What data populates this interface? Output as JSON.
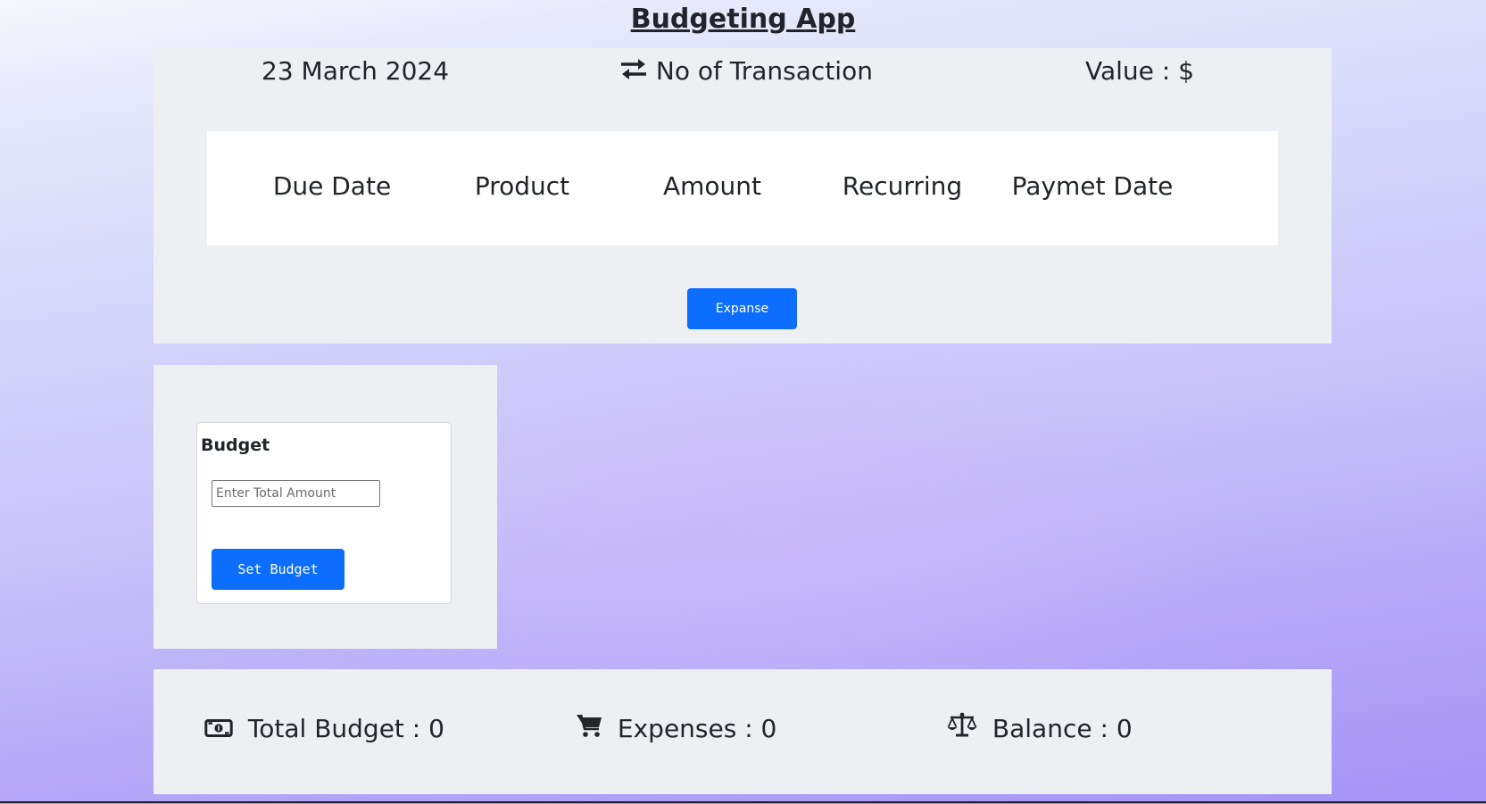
{
  "app": {
    "title": "Budgeting App"
  },
  "stats": {
    "date": "23 March 2024",
    "transactions_label": "No of Transaction",
    "transactions_icon": "exchange-arrows-icon",
    "value_label": "Value : $"
  },
  "table": {
    "columns": [
      "Due Date",
      "Product",
      "Amount",
      "Recurring",
      "Paymet Date"
    ]
  },
  "expanse_button": {
    "label": "Expanse"
  },
  "budget_form": {
    "label": "Budget",
    "input_placeholder": "Enter Total Amount",
    "input_value": "",
    "submit_label": "Set Budget"
  },
  "summary": {
    "total_budget": {
      "label": "Total Budget : 0",
      "icon": "money-bill-icon"
    },
    "expenses": {
      "label": "Expenses : 0",
      "icon": "shopping-cart-icon"
    },
    "balance": {
      "label": "Balance : 0",
      "icon": "balance-scale-icon"
    }
  },
  "colors": {
    "primary_button": "#0d6efd",
    "panel_background": "#eeeff3",
    "page_gradient_start": "#f7f8fd",
    "page_gradient_end": "#a593f6"
  }
}
